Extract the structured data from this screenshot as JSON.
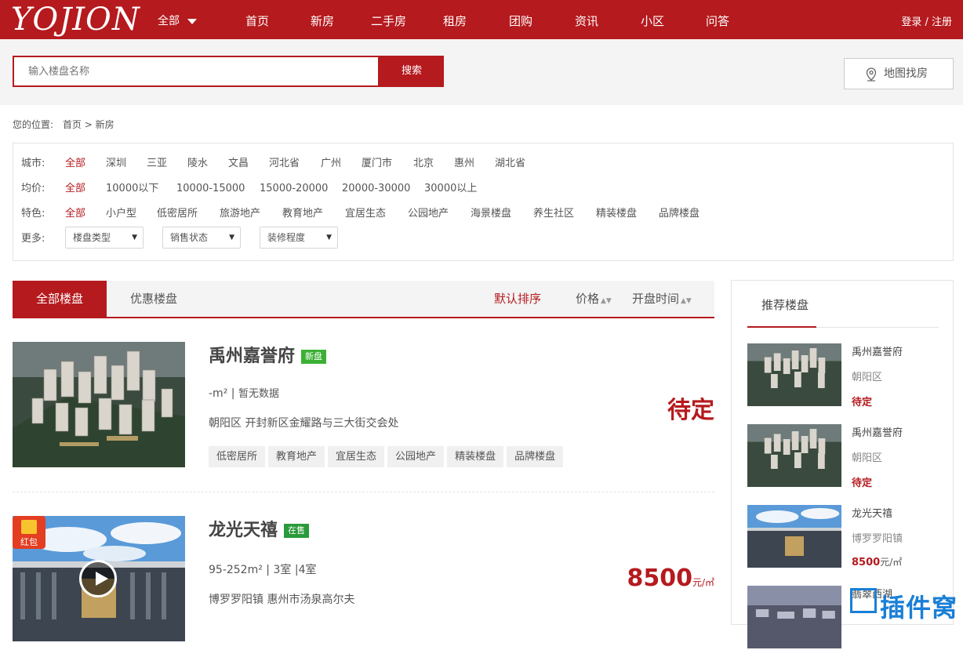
{
  "header": {
    "logo": "YOJION",
    "scope": "全部",
    "nav": [
      "首页",
      "新房",
      "二手房",
      "租房",
      "团购",
      "资讯",
      "小区",
      "问答"
    ],
    "auth": "登录 / 注册"
  },
  "search": {
    "placeholder": "输入楼盘名称",
    "button": "搜索",
    "map_button": "地图找房"
  },
  "breadcrumb": {
    "prefix": "您的位置:",
    "home": "首页",
    "sep": ">",
    "current": "新房"
  },
  "filters": {
    "city": {
      "label": "城市:",
      "options": [
        "全部",
        "深圳",
        "三亚",
        "陵水",
        "文昌",
        "河北省",
        "广州",
        "厦门市",
        "北京",
        "惠州",
        "湖北省"
      ]
    },
    "price": {
      "label": "均价:",
      "options": [
        "全部",
        "10000以下",
        "10000-15000",
        "15000-20000",
        "20000-30000",
        "30000以上"
      ]
    },
    "feature": {
      "label": "特色:",
      "options": [
        "全部",
        "小户型",
        "低密居所",
        "旅游地产",
        "教育地产",
        "宜居生态",
        "公园地产",
        "海景楼盘",
        "养生社区",
        "精装楼盘",
        "品牌楼盘"
      ]
    },
    "more": {
      "label": "更多:",
      "selects": [
        "楼盘类型",
        "销售状态",
        "装修程度"
      ]
    }
  },
  "tabs": {
    "items": [
      "全部楼盘",
      "优惠楼盘"
    ],
    "sort": [
      "默认排序",
      "价格",
      "开盘时间"
    ]
  },
  "listings": [
    {
      "name": "禹州嘉誉府",
      "badge": "新盘",
      "area": "-m²",
      "sep": "|",
      "rooms": "暂无数据",
      "address": "朝阳区 开封新区金耀路与三大街交会处",
      "tags": [
        "低密居所",
        "教育地产",
        "宜居生态",
        "公园地产",
        "精装楼盘",
        "品牌楼盘"
      ],
      "price": "待定"
    },
    {
      "name": "龙光天禧",
      "badge": "在售",
      "area": "95-252m²",
      "sep": "|",
      "rooms": "3室",
      "sep2": "|",
      "rooms2": "4室",
      "address": "博罗罗阳镇 惠州市汤泉高尔夫",
      "price": "8500",
      "unit": "元/㎡",
      "hongbao": "红包"
    }
  ],
  "recommend": {
    "title": "推荐楼盘",
    "items": [
      {
        "name": "禹州嘉誉府",
        "district": "朝阳区",
        "price": "待定"
      },
      {
        "name": "禹州嘉誉府",
        "district": "朝阳区",
        "price": "待定"
      },
      {
        "name": "龙光天禧",
        "district": "博罗罗阳镇",
        "price": "8500",
        "unit": "元/㎡"
      },
      {
        "name": "翡翠西湖",
        "district": "",
        "price": ""
      }
    ]
  },
  "watermark": "插件窝",
  "colors": {
    "brand": "#b51a1e",
    "badge_new": "#3cb035",
    "badge_sale": "#2a9a3a",
    "watermark": "#1a7fd6"
  }
}
